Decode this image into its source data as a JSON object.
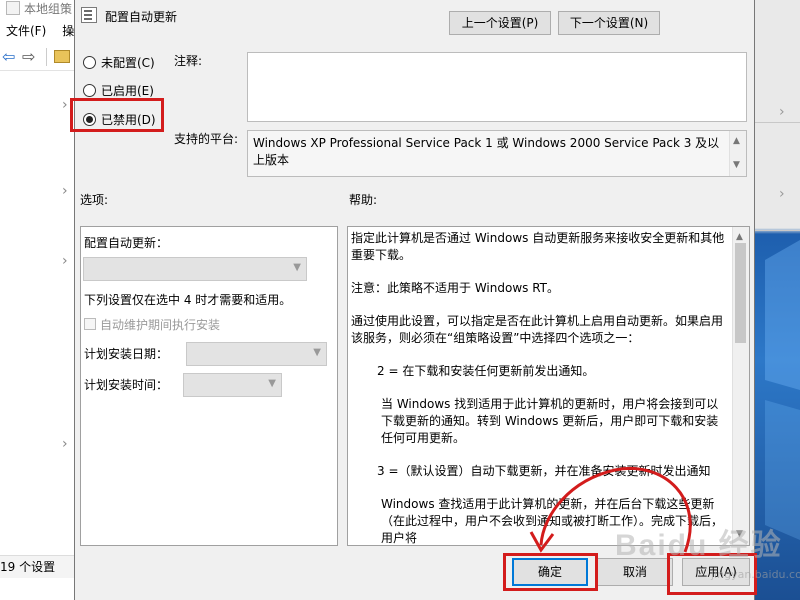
{
  "background_window": {
    "title": "本地组策",
    "menu": [
      "文件(F)",
      "操"
    ],
    "status": "19 个设置"
  },
  "dialog": {
    "title": "配置自动更新",
    "prev_button": "上一个设置(P)",
    "next_button": "下一个设置(N)",
    "radios": {
      "not_configured": "未配置(C)",
      "enabled": "已启用(E)",
      "disabled": "已禁用(D)",
      "selected": "disabled"
    },
    "comment_label": "注释:",
    "comment_value": "",
    "platform_label": "支持的平台:",
    "platform_value": "Windows XP Professional Service Pack 1 或 Windows 2000 Service Pack 3 及以上版本",
    "options_label": "选项:",
    "help_label": "帮助:",
    "options": {
      "configure_label": "配置自动更新：",
      "note": "下列设置仅在选中 4 时才需要和适用。",
      "maintenance_checkbox": "自动维护期间执行安装",
      "day_label": "计划安装日期：",
      "time_label": "计划安装时间："
    },
    "help_paragraphs": [
      "指定此计算机是否通过 Windows 自动更新服务来接收安全更新和其他重要下载。",
      "注意：此策略不适用于 Windows RT。",
      "通过使用此设置，可以指定是否在此计算机上启用自动更新。如果启用该服务，则必须在“组策略设置”中选择四个选项之一：",
      "2 = 在下载和安装任何更新前发出通知。",
      "当 Windows 找到适用于此计算机的更新时，用户将会接到可以下载更新的通知。转到 Windows 更新后，用户即可下载和安装任何可用更新。",
      "3 =（默认设置）自动下载更新，并在准备安装更新时发出通知",
      "Windows 查找适用于此计算机的更新，并在后台下载这些更新（在此过程中，用户不会收到通知或被打断工作）。完成下载后，用户将"
    ],
    "ok_button": "确定",
    "cancel_button": "取消",
    "apply_button": "应用(A)"
  },
  "watermark": {
    "brand": "Baidu 经验",
    "url": "jingyan.baidu.com"
  },
  "colors": {
    "highlight": "#d31c1c",
    "dialog_bg": "#f0f0f0",
    "default_button_border": "#0078d7"
  }
}
